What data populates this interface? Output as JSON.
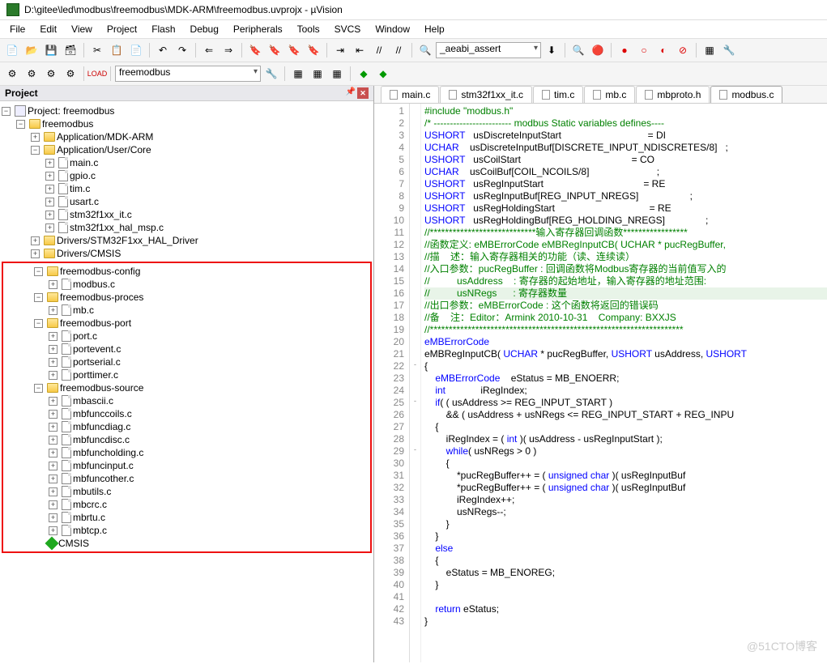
{
  "title": "D:\\gitee\\led\\modbus\\freemodbus\\MDK-ARM\\freemodbus.uvprojx - µVision",
  "menu": [
    "File",
    "Edit",
    "View",
    "Project",
    "Flash",
    "Debug",
    "Peripherals",
    "Tools",
    "SVCS",
    "Window",
    "Help"
  ],
  "toolbar_combo1": "_aeabi_assert",
  "target_combo": "freemodbus",
  "pane_title": "Project",
  "tree": {
    "root": "Project: freemodbus",
    "target": "freemodbus",
    "groups": [
      {
        "name": "Application/MDK-ARM",
        "open": false
      },
      {
        "name": "Application/User/Core",
        "open": true,
        "files": [
          "main.c",
          "gpio.c",
          "tim.c",
          "usart.c",
          "stm32f1xx_it.c",
          "stm32f1xx_hal_msp.c"
        ]
      },
      {
        "name": "Drivers/STM32F1xx_HAL_Driver",
        "open": false
      },
      {
        "name": "Drivers/CMSIS",
        "open": false
      }
    ],
    "highlighted": [
      {
        "name": "freemodbus-config",
        "files": [
          "modbus.c"
        ]
      },
      {
        "name": "freemodbus-proces",
        "files": [
          "mb.c"
        ]
      },
      {
        "name": "freemodbus-port",
        "files": [
          "port.c",
          "portevent.c",
          "portserial.c",
          "porttimer.c"
        ]
      },
      {
        "name": "freemodbus-source",
        "files": [
          "mbascii.c",
          "mbfunccoils.c",
          "mbfuncdiag.c",
          "mbfuncdisc.c",
          "mbfuncholding.c",
          "mbfuncinput.c",
          "mbfuncother.c",
          "mbutils.c",
          "mbcrc.c",
          "mbrtu.c",
          "mbtcp.c"
        ]
      }
    ],
    "cmsis": "CMSIS"
  },
  "tabs": [
    "main.c",
    "stm32f1xx_it.c",
    "tim.c",
    "mb.c",
    "mbproto.h",
    "modbus.c"
  ],
  "active_tab": 5,
  "code_lines": [
    {
      "n": 1,
      "t": "#include \"modbus.h\"",
      "cls": "pp"
    },
    {
      "n": 2,
      "t": "/* ------------------------ modbus Static variables defines----",
      "cls": "cmt"
    },
    {
      "n": 3,
      "t": "USHORT   usDiscreteInputStart                                = DI"
    },
    {
      "n": 4,
      "t": "UCHAR    usDiscreteInputBuf[DISCRETE_INPUT_NDISCRETES/8]   ;"
    },
    {
      "n": 5,
      "t": "USHORT   usCoilStart                                         = CO"
    },
    {
      "n": 6,
      "t": "UCHAR    usCoilBuf[COIL_NCOILS/8]                         ;"
    },
    {
      "n": 7,
      "t": "USHORT   usRegInputStart                                     = RE"
    },
    {
      "n": 8,
      "t": "USHORT   usRegInputBuf[REG_INPUT_NREGS]                   ;"
    },
    {
      "n": 9,
      "t": "USHORT   usRegHoldingStart                                   = RE"
    },
    {
      "n": 10,
      "t": "USHORT   usRegHoldingBuf[REG_HOLDING_NREGS]               ;"
    },
    {
      "n": 11,
      "t": "//****************************输入寄存器回调函数*****************",
      "cls": "cmt"
    },
    {
      "n": 12,
      "t": "//函数定义: eMBErrorCode eMBRegInputCB( UCHAR * pucRegBuffer,",
      "cls": "cmt"
    },
    {
      "n": 13,
      "t": "//描    述：输入寄存器相关的功能（读、连续读）",
      "cls": "cmt"
    },
    {
      "n": 14,
      "t": "//入口参数：pucRegBuffer : 回调函数将Modbus寄存器的当前值写入的",
      "cls": "cmt"
    },
    {
      "n": 15,
      "t": "//          usAddress    : 寄存器的起始地址，输入寄存器的地址范围:",
      "cls": "cmt"
    },
    {
      "n": 16,
      "t": "//          usNRegs      : 寄存器数量",
      "cls": "cmt",
      "hl": true
    },
    {
      "n": 17,
      "t": "//出口参数：eMBErrorCode : 这个函数将返回的错误码",
      "cls": "cmt"
    },
    {
      "n": 18,
      "t": "//备    注：Editor：Armink 2010-10-31    Company: BXXJS",
      "cls": "cmt"
    },
    {
      "n": 19,
      "t": "//*******************************************************************",
      "cls": "cmt"
    },
    {
      "n": 20,
      "t": "eMBErrorCode"
    },
    {
      "n": 21,
      "t": "eMBRegInputCB( UCHAR * pucRegBuffer, USHORT usAddress, USHORT"
    },
    {
      "n": 22,
      "t": "{",
      "fold": "-"
    },
    {
      "n": 23,
      "t": "    eMBErrorCode    eStatus = MB_ENOERR;"
    },
    {
      "n": 24,
      "t": "    int             iRegIndex;"
    },
    {
      "n": 25,
      "t": "    if( ( usAddress >= REG_INPUT_START )",
      "fold": "-"
    },
    {
      "n": 26,
      "t": "        && ( usAddress + usNRegs <= REG_INPUT_START + REG_INPU"
    },
    {
      "n": 27,
      "t": "    {"
    },
    {
      "n": 28,
      "t": "        iRegIndex = ( int )( usAddress - usRegInputStart );"
    },
    {
      "n": 29,
      "t": "        while( usNRegs > 0 )",
      "fold": "-"
    },
    {
      "n": 30,
      "t": "        {"
    },
    {
      "n": 31,
      "t": "            *pucRegBuffer++ = ( unsigned char )( usRegInputBuf"
    },
    {
      "n": 32,
      "t": "            *pucRegBuffer++ = ( unsigned char )( usRegInputBuf"
    },
    {
      "n": 33,
      "t": "            iRegIndex++;"
    },
    {
      "n": 34,
      "t": "            usNRegs--;"
    },
    {
      "n": 35,
      "t": "        }"
    },
    {
      "n": 36,
      "t": "    }"
    },
    {
      "n": 37,
      "t": "    else"
    },
    {
      "n": 38,
      "t": "    {"
    },
    {
      "n": 39,
      "t": "        eStatus = MB_ENOREG;"
    },
    {
      "n": 40,
      "t": "    }"
    },
    {
      "n": 41,
      "t": ""
    },
    {
      "n": 42,
      "t": "    return eStatus;"
    },
    {
      "n": 43,
      "t": "}"
    }
  ],
  "watermark": "@51CTO博客"
}
